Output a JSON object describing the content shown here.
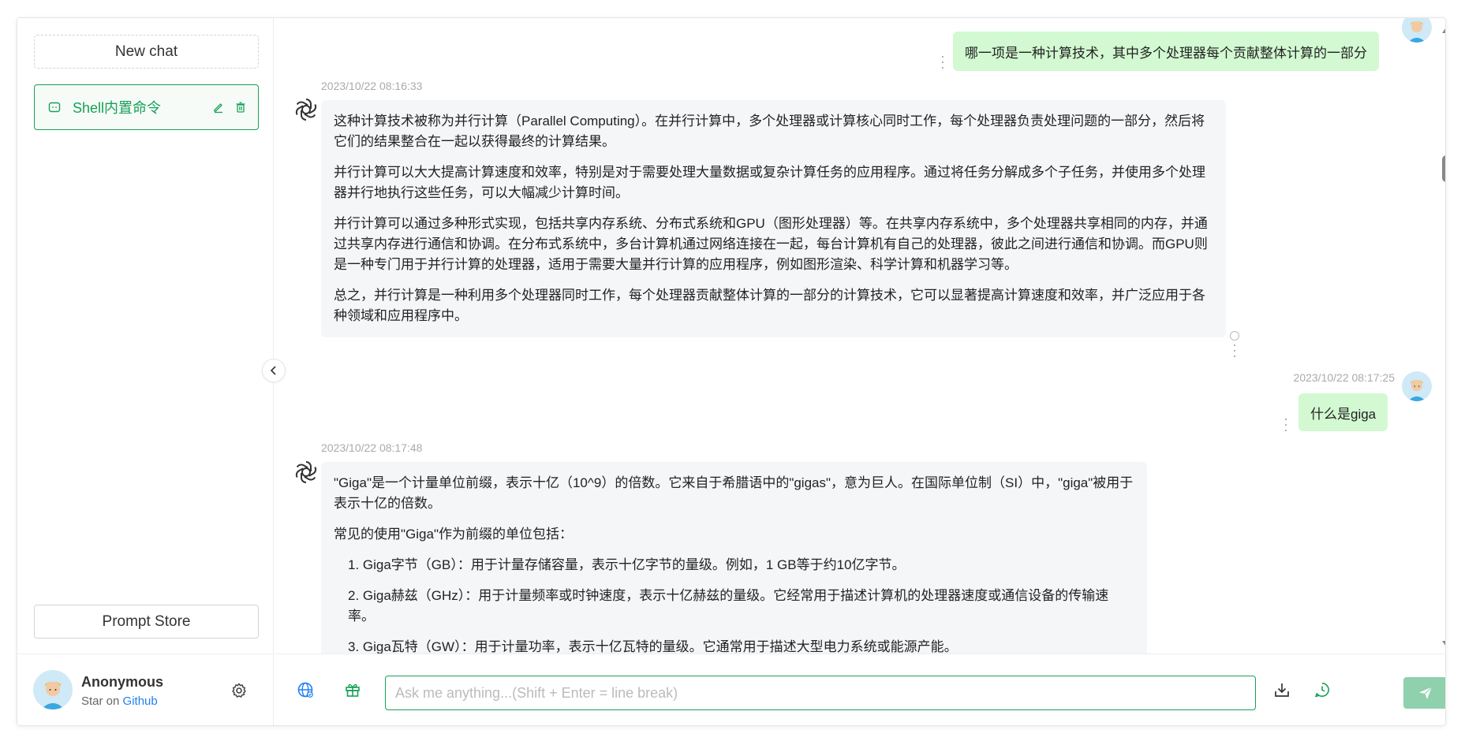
{
  "sidebar": {
    "new_chat_label": "New chat",
    "chats": [
      {
        "title": "Shell内置命令"
      }
    ],
    "prompt_store_label": "Prompt Store",
    "user": {
      "name": "Anonymous",
      "sub_prefix": "Star on ",
      "sub_link": "Github"
    }
  },
  "messages": {
    "m1": {
      "role": "user",
      "text": "哪一项是一种计算技术，其中多个处理器每个贡献整体计算的一部分"
    },
    "m2": {
      "role": "assistant",
      "time": "2023/10/22 08:16:33",
      "paragraphs": [
        "这种计算技术被称为并行计算（Parallel Computing）。在并行计算中，多个处理器或计算核心同时工作，每个处理器负责处理问题的一部分，然后将它们的结果整合在一起以获得最终的计算结果。",
        "并行计算可以大大提高计算速度和效率，特别是对于需要处理大量数据或复杂计算任务的应用程序。通过将任务分解成多个子任务，并使用多个处理器并行地执行这些任务，可以大幅减少计算时间。",
        "并行计算可以通过多种形式实现，包括共享内存系统、分布式系统和GPU（图形处理器）等。在共享内存系统中，多个处理器共享相同的内存，并通过共享内存进行通信和协调。在分布式系统中，多台计算机通过网络连接在一起，每台计算机有自己的处理器，彼此之间进行通信和协调。而GPU则是一种专门用于并行计算的处理器，适用于需要大量并行计算的应用程序，例如图形渲染、科学计算和机器学习等。",
        "总之，并行计算是一种利用多个处理器同时工作，每个处理器贡献整体计算的一部分的计算技术，它可以显著提高计算速度和效率，并广泛应用于各种领域和应用程序中。"
      ]
    },
    "m3": {
      "role": "user",
      "time": "2023/10/22 08:17:25",
      "text": "什么是giga"
    },
    "m4": {
      "role": "assistant",
      "time": "2023/10/22 08:17:48",
      "p1": "\"Giga\"是一个计量单位前缀，表示十亿（10^9）的倍数。它来自于希腊语中的\"gigas\"，意为巨人。在国际单位制（SI）中，\"giga\"被用于表示十亿的倍数。",
      "p2": "常见的使用\"Giga\"作为前缀的单位包括：",
      "list": [
        "1. Giga字节（GB）：用于计量存储容量，表示十亿字节的量级。例如，1 GB等于约10亿字节。",
        "2. Giga赫兹（GHz）：用于计量频率或时钟速度，表示十亿赫兹的量级。它经常用于描述计算机的处理器速度或通信设备的传输速率。",
        "3. Giga瓦特（GW）：用于计量功率，表示十亿瓦特的量级。它通常用于描述大型电力系统或能源产能。"
      ]
    }
  },
  "input": {
    "placeholder": "Ask me anything...(Shift + Enter = line break)",
    "value": ""
  },
  "colors": {
    "accent": "#18a058",
    "user_bubble": "#d2f9d1",
    "ai_bubble": "#f4f6f8",
    "link": "#2080f0",
    "send_disabled": "#8fd0ad"
  }
}
